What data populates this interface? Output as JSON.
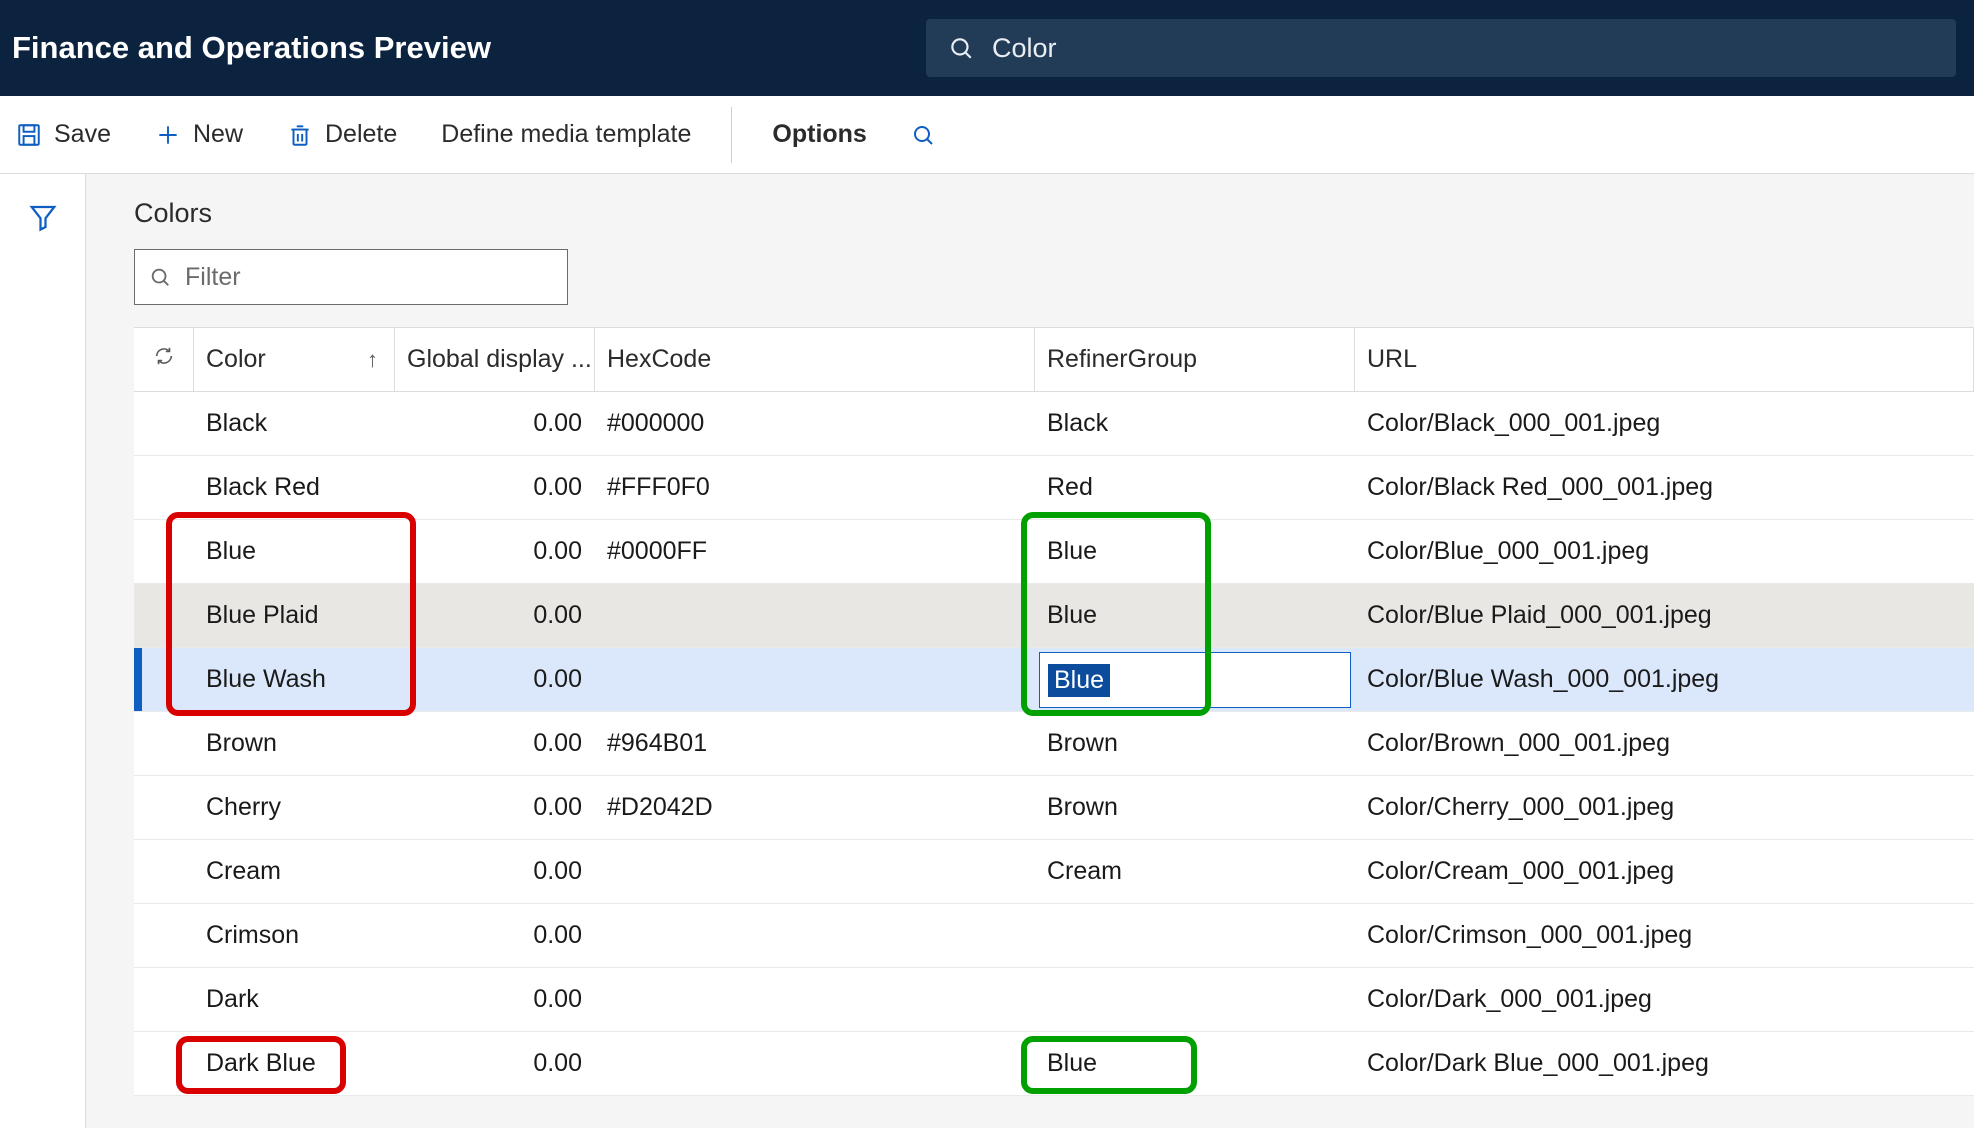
{
  "header": {
    "title": "Finance and Operations Preview",
    "search_value": "Color",
    "search_placeholder": ""
  },
  "commands": {
    "save": "Save",
    "new": "New",
    "delete": "Delete",
    "define_media_template": "Define media template",
    "options": "Options"
  },
  "page": {
    "title": "Colors",
    "filter_placeholder": "Filter"
  },
  "columns": {
    "color": "Color",
    "gdisplay": "Global display ...",
    "hex": "HexCode",
    "refiner": "RefinerGroup",
    "url": "URL"
  },
  "rows": [
    {
      "color": "Black",
      "gdisplay": "0.00",
      "hex": "#000000",
      "refiner": "Black",
      "url": "Color/Black_000_001.jpeg",
      "state": "normal"
    },
    {
      "color": "Black Red",
      "gdisplay": "0.00",
      "hex": "#FFF0F0",
      "refiner": "Red",
      "url": "Color/Black Red_000_001.jpeg",
      "state": "normal"
    },
    {
      "color": "Blue",
      "gdisplay": "0.00",
      "hex": "#0000FF",
      "refiner": "Blue",
      "url": "Color/Blue_000_001.jpeg",
      "state": "normal"
    },
    {
      "color": "Blue Plaid",
      "gdisplay": "0.00",
      "hex": "",
      "refiner": "Blue",
      "url": "Color/Blue Plaid_000_001.jpeg",
      "state": "alt"
    },
    {
      "color": "Blue Wash",
      "gdisplay": "0.00",
      "hex": "",
      "refiner": "Blue",
      "url": "Color/Blue Wash_000_001.jpeg",
      "state": "selected",
      "editing_refiner": "Blue"
    },
    {
      "color": "Brown",
      "gdisplay": "0.00",
      "hex": "#964B01",
      "refiner": "Brown",
      "url": "Color/Brown_000_001.jpeg",
      "state": "normal"
    },
    {
      "color": "Cherry",
      "gdisplay": "0.00",
      "hex": "#D2042D",
      "refiner": "Brown",
      "url": "Color/Cherry_000_001.jpeg",
      "state": "normal"
    },
    {
      "color": "Cream",
      "gdisplay": "0.00",
      "hex": "",
      "refiner": "Cream",
      "url": "Color/Cream_000_001.jpeg",
      "state": "normal"
    },
    {
      "color": "Crimson",
      "gdisplay": "0.00",
      "hex": "",
      "refiner": "",
      "url": "Color/Crimson_000_001.jpeg",
      "state": "normal"
    },
    {
      "color": "Dark",
      "gdisplay": "0.00",
      "hex": "",
      "refiner": "",
      "url": "Color/Dark_000_001.jpeg",
      "state": "normal"
    },
    {
      "color": "Dark Blue",
      "gdisplay": "0.00",
      "hex": "",
      "refiner": "Blue",
      "url": "Color/Dark Blue_000_001.jpeg",
      "state": "normal"
    }
  ],
  "annotations": [
    {
      "type": "red",
      "target": "color-block-blue",
      "desc": "Blue/Blue Plaid/Blue Wash color cells",
      "top_row": 2,
      "bottom_row": 4,
      "col": "color"
    },
    {
      "type": "green",
      "target": "refiner-block-blue",
      "desc": "Blue refiner cells",
      "top_row": 2,
      "bottom_row": 4,
      "col": "refiner"
    },
    {
      "type": "red",
      "target": "color-darkblue",
      "desc": "Dark Blue color cell",
      "top_row": 10,
      "bottom_row": 10,
      "col": "color",
      "tight": true
    },
    {
      "type": "green",
      "target": "refiner-darkblue",
      "desc": "Dark Blue refiner cell",
      "top_row": 10,
      "bottom_row": 10,
      "col": "refiner",
      "tight": true
    }
  ]
}
